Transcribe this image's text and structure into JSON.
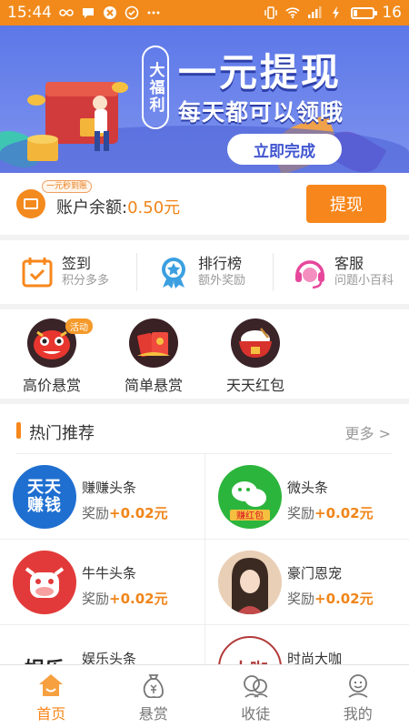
{
  "status_bar": {
    "time": "15:44",
    "battery": "16"
  },
  "banner": {
    "tag": "大福利",
    "title": "一元提现",
    "subtitle": "每天都可以领哦",
    "button": "立即完成"
  },
  "balance": {
    "mini_tag": "一元秒到账",
    "label": "账户余额:",
    "value": "0.50元",
    "withdraw": "提现"
  },
  "quick": [
    {
      "title": "签到",
      "sub": "积分多多",
      "icon": "calendar-check-icon"
    },
    {
      "title": "排行榜",
      "sub": "额外奖励",
      "icon": "medal-badge-icon"
    },
    {
      "title": "客服",
      "sub": "问题小百科",
      "icon": "headset-icon"
    }
  ],
  "tasks": [
    {
      "label": "高价悬赏",
      "badge": "活动",
      "icon": "lion-dance-icon"
    },
    {
      "label": "简单悬赏",
      "icon": "red-envelope-icon"
    },
    {
      "label": "天天红包",
      "icon": "rice-bowl-icon"
    }
  ],
  "recommend": {
    "title": "热门推荐",
    "more": "更多 >",
    "items": [
      {
        "name": "赚赚头条",
        "reward_label": "奖励",
        "reward_value": "+0.02元",
        "logo_text": "天天赚钱",
        "logo_color": "#1f6fd0"
      },
      {
        "name": "微头条",
        "reward_label": "奖励",
        "reward_value": "+0.02元",
        "logo_text": "赚红包",
        "logo_color": "#2cb53c"
      },
      {
        "name": "牛牛头条",
        "reward_label": "奖励",
        "reward_value": "+0.02元",
        "logo_color": "#e23a3a"
      },
      {
        "name": "豪门恩宠",
        "reward_label": "奖励",
        "reward_value": "+0.02元",
        "logo_color": "#f0d2b8"
      },
      {
        "name": "娱乐头条",
        "reward_label": "",
        "reward_value": "",
        "logo_text": "娱乐",
        "logo_color": "#ffffff"
      },
      {
        "name": "时尚大咖",
        "reward_label": "",
        "reward_value": "",
        "logo_text": "大咖",
        "logo_color": "#ffffff"
      }
    ]
  },
  "nav": [
    {
      "label": "首页",
      "active": true,
      "icon": "home-icon"
    },
    {
      "label": "悬赏",
      "icon": "money-bag-icon"
    },
    {
      "label": "收徒",
      "icon": "apprentice-icon"
    },
    {
      "label": "我的",
      "icon": "profile-icon"
    }
  ],
  "colors": {
    "accent": "#f7871c",
    "banner": "#5c78e8",
    "reward": "#f08519"
  }
}
